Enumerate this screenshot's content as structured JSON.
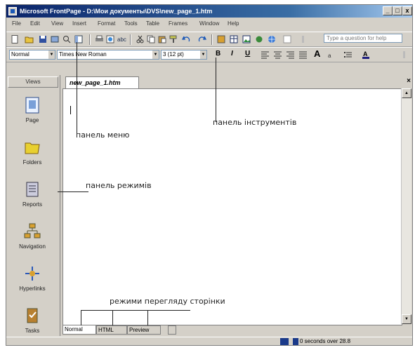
{
  "window": {
    "title": "Microsoft FrontPage - D:\\Мои документы\\DVS\\new_page_1.htm",
    "controls": [
      "_",
      "□",
      "x"
    ]
  },
  "menu": {
    "items": [
      "File",
      "Edit",
      "View",
      "Insert",
      "Format",
      "Tools",
      "Table",
      "Frames",
      "Window",
      "Help"
    ],
    "ask_placeholder": "Type a question for help"
  },
  "format_bar": {
    "style": "Normal",
    "font": "Times New Roman",
    "size": "3 (12 pt)",
    "bold": "B",
    "italic": "I",
    "underline": "U",
    "grow_font": "A"
  },
  "views_panel": {
    "header": "Views",
    "items": [
      {
        "label": "Page",
        "icon": "page-view-icon"
      },
      {
        "label": "Folders",
        "icon": "folders-view-icon"
      },
      {
        "label": "Reports",
        "icon": "reports-view-icon"
      },
      {
        "label": "Navigation",
        "icon": "navigation-view-icon"
      },
      {
        "label": "Hyperlinks",
        "icon": "hyperlinks-view-icon"
      },
      {
        "label": "Tasks",
        "icon": "tasks-view-icon"
      }
    ]
  },
  "document": {
    "tab_label": "new_page_1.htm",
    "close": "×",
    "mode_tabs": [
      "Normal",
      "HTML",
      "Preview"
    ]
  },
  "status": {
    "text": "0 seconds over 28.8"
  },
  "annotations": {
    "menu_panel": "панель меню",
    "toolbars_panel": "панель інструментів",
    "modes_panel": "панель режимів",
    "page_view_modes": "режими перегляду сторінки"
  },
  "colors": {
    "titlebar_start": "#0a246a",
    "titlebar_end": "#a6caf0",
    "chrome": "#d4d0c8"
  }
}
